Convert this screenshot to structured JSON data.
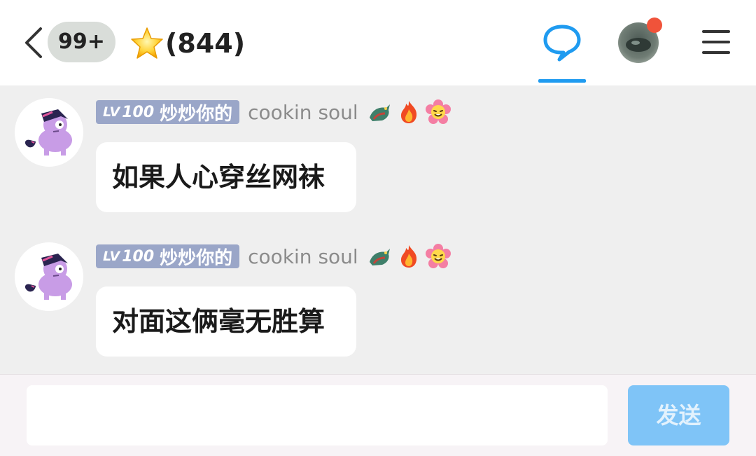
{
  "header": {
    "unread_badge": "99+",
    "member_count": "(844)",
    "icons": {
      "back": "chevron-left-icon",
      "star": "star-icon",
      "chat": "chat-bubble-icon",
      "menu": "hamburger-menu-icon"
    },
    "accent_color": "#1f9bf0",
    "notification_dot_color": "#f0533a"
  },
  "messages": [
    {
      "level_prefix": "LV",
      "level_number": "100",
      "level_title": "炒炒你的",
      "username": "cookin soul",
      "badges": [
        "dragon-badge-icon",
        "fire-badge-icon",
        "flower-badge-icon"
      ],
      "text": "如果人心穿丝网袜"
    },
    {
      "level_prefix": "LV",
      "level_number": "100",
      "level_title": "炒炒你的",
      "username": "cookin soul",
      "badges": [
        "dragon-badge-icon",
        "fire-badge-icon",
        "flower-badge-icon"
      ],
      "text": "对面这俩毫无胜算"
    }
  ],
  "composer": {
    "input_value": "",
    "send_label": "发送"
  }
}
